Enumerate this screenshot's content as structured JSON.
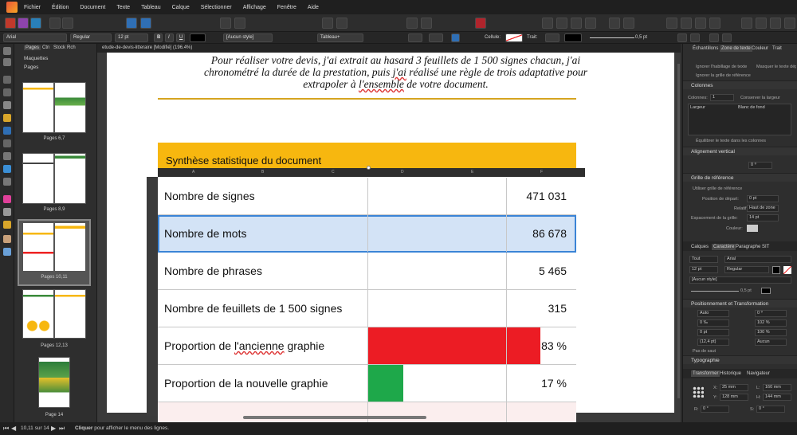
{
  "menu": [
    "Fichier",
    "Édition",
    "Document",
    "Texte",
    "Tableau",
    "Calque",
    "Sélectionner",
    "Affichage",
    "Fenêtre",
    "Aide"
  ],
  "context": {
    "font": "Arial",
    "style": "Regular",
    "size": "12 pt",
    "bold": "B",
    "italic": "I",
    "underline": "U",
    "para_style": "[Aucun style]",
    "table_format": "Tableau+",
    "cell_label": "Cellule:",
    "stroke_label": "Trait:",
    "stroke_width": "0,5 pt"
  },
  "pages_panel": {
    "tabs": [
      "Pages",
      "Ctn",
      "Stock",
      "Rch"
    ],
    "masters": "Maquettes",
    "pages": "Pages",
    "thumbs": [
      "Pages 6,7",
      "Pages 8,9",
      "Pages 10,11",
      "Pages 12,13",
      "Page 14"
    ]
  },
  "document": {
    "tab_title": "etude-de-devis-litteraire [Modifié] (196.4%)",
    "intro_line1": "Pour réaliser votre devis, j'ai extrait au hasard 3 feuillets de 1 500 signes chacun, j'ai",
    "intro_line2a": "chronométré la durée de la prestation, puis ",
    "intro_line2b": "j'ai",
    "intro_line2c": " réalisé une règle de trois adaptative pour",
    "intro_line3a": "extrapoler à ",
    "intro_line3b": "l'ensemble",
    "intro_line3c": " de votre document.",
    "section_title": "Synthèse statistique du document",
    "col_letters": [
      "A",
      "B",
      "C",
      "D",
      "E",
      "F"
    ],
    "rows": [
      {
        "label": "Nombre de signes",
        "value": "471 031"
      },
      {
        "label": "Nombre de mots",
        "value": "86 678"
      },
      {
        "label": "Nombre de phrases",
        "value": "5 465"
      },
      {
        "label": "Nombre de feuillets de 1 500 signes",
        "value": "315"
      },
      {
        "label_a": "Proportion de ",
        "label_b": "l'ancienne",
        "label_c": " graphie",
        "value": "83 %",
        "share": 0.83,
        "color": "#ec1c24"
      },
      {
        "label": "Proportion de la nouvelle graphie",
        "value": "17 %",
        "share": 0.17,
        "color": "#1ea84a"
      }
    ]
  },
  "right_panel": {
    "tabs_top": [
      "Échantillons",
      "Zone de texte",
      "Couleur",
      "Trait"
    ],
    "ignore_wrap": "Ignorer l'habillage de texte",
    "mask_text": "Masquer le texte dépassant",
    "ignore_grid": "Ignorer la grille de référence",
    "columns_section": "Colonnes",
    "columns_label": "Colonnes:",
    "columns_value": "1",
    "keep_width": "Conserver la largeur",
    "col_width_header": "Largeur",
    "col_gutter_header": "Blanc de fond",
    "balance": "Équilibrer le texte dans les colonnes",
    "vertical_align": "Alignement vertical",
    "align_value": "0 ⁰",
    "baseline_grid": "Grille de référence",
    "use_grid": "Utiliser grille de référence",
    "start_pos": "Position de départ:",
    "start_val": "0 pt",
    "relative": "Relatif à:",
    "relative_val": "Haut de zone",
    "spacing": "Espacement de la grille:",
    "spacing_val": "14 pt",
    "color_label": "Couleur:",
    "tabs_mid": [
      "Calques",
      "Caractère",
      "Paragraphe",
      "SIT"
    ],
    "char_all": "Tout",
    "char_font": "Arial",
    "char_size": "12 pt",
    "char_style": "Regular",
    "char_para_style": "[Aucun style]",
    "char_stroke": "0,5 pt",
    "pos_transform": "Positionnement et Transformation",
    "pt_auto": "Auto",
    "pt_0": "0 ⁰",
    "pt_pct": "0 ‰",
    "pt_100a": "102 %",
    "pt_0pt": "0 pt",
    "pt_100b": "100 %",
    "pt_124": "(12,4 pt)",
    "pt_aucun": "Aucun",
    "no_break": "Pas de saut",
    "typography": "Typographie",
    "tabs_bottom": [
      "Transformer",
      "Historique",
      "Navigateur"
    ],
    "x_label": "X:",
    "x_val": "25 mm",
    "y_label": "Y:",
    "y_val": "128 mm",
    "l_label": "L:",
    "l_val": "160 mm",
    "h_label": "H:",
    "h_val": "144 mm",
    "r_label": "R:",
    "r_val": "0 °",
    "s_label": "S:",
    "s_val": "0 °"
  },
  "status": {
    "page": "10,11 sur 14",
    "hint_bold": "Cliquer",
    "hint_rest": " pour afficher le menu des lignes."
  }
}
